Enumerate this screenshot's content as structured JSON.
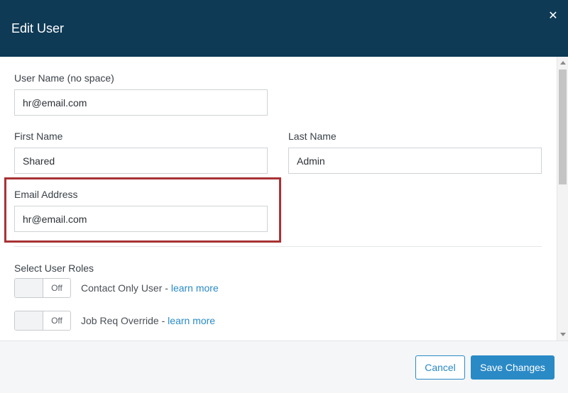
{
  "dialog": {
    "title": "Edit User",
    "close_icon": "close-icon",
    "close_glyph": "✕"
  },
  "form": {
    "username": {
      "label": "User Name (no space)",
      "value": "hr@email.com"
    },
    "first_name": {
      "label": "First Name",
      "value": "Shared"
    },
    "last_name": {
      "label": "Last Name",
      "value": "Admin"
    },
    "email": {
      "label": "Email Address",
      "value": "hr@email.com"
    }
  },
  "roles": {
    "heading": "Select User Roles",
    "items": [
      {
        "name": "Contact Only User",
        "separator": " - ",
        "link": "learn more",
        "toggle": "Off"
      },
      {
        "name": "Job Req Override",
        "separator": " - ",
        "link": "learn more",
        "toggle": "Off"
      }
    ]
  },
  "footer": {
    "cancel_label": "Cancel",
    "save_label": "Save Changes"
  },
  "colors": {
    "header_bg": "#0e3a55",
    "accent": "#2a8ac6",
    "highlight_border": "#a83235"
  }
}
